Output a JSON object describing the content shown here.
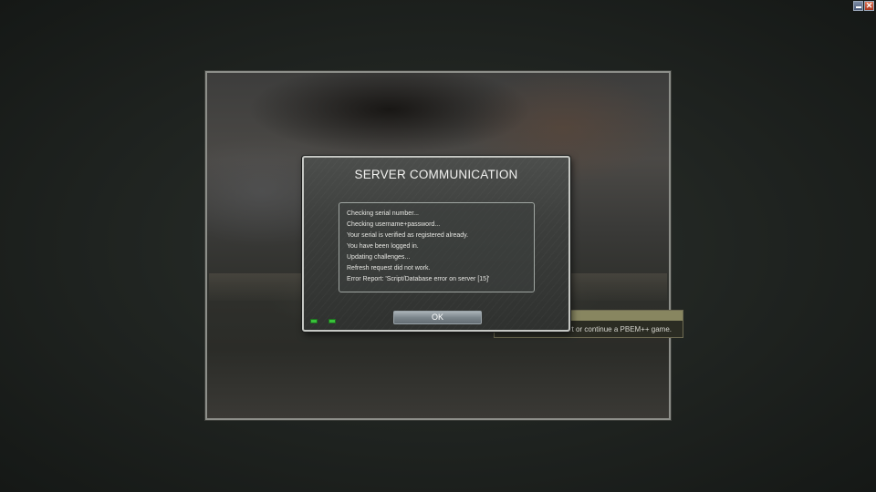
{
  "window_controls": {
    "minimize_icon": "minimize-icon",
    "close_icon": "close-icon",
    "close_glyph": "✕"
  },
  "tooltip": {
    "text": "o start or continue a PBEM++ game."
  },
  "dialog": {
    "title": "SERVER COMMUNICATION",
    "log_lines": [
      "Checking serial number...",
      "Checking username+password...",
      "Your serial is verified as registered already.",
      "You have been logged in.",
      "Updating challenges...",
      "Refresh request did not work.",
      "Error Report: 'Script/Database error on server [15]'"
    ],
    "ok_label": "OK",
    "status_leds": [
      "#38c23a",
      "#38c23a"
    ]
  }
}
